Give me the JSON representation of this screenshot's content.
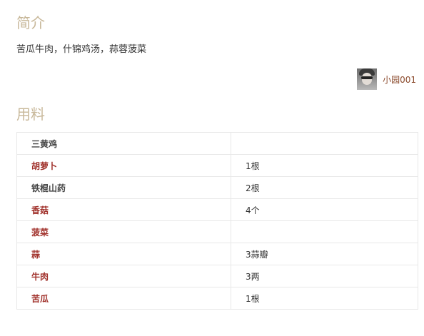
{
  "intro": {
    "title": "简介",
    "text": "苦瓜牛肉，什锦鸡汤，蒜蓉菠菜"
  },
  "author": {
    "name": "小园001"
  },
  "ingredients": {
    "title": "用料",
    "rows": [
      {
        "name": "三黄鸡",
        "amount": "",
        "linked": false
      },
      {
        "name": "胡萝卜",
        "amount": "1根",
        "linked": true
      },
      {
        "name": "铁棍山药",
        "amount": "2根",
        "linked": false
      },
      {
        "name": "香菇",
        "amount": "4个",
        "linked": true
      },
      {
        "name": "菠菜",
        "amount": "",
        "linked": true
      },
      {
        "name": "蒜",
        "amount": "3蒜瓣",
        "linked": true
      },
      {
        "name": "牛肉",
        "amount": "3两",
        "linked": true
      },
      {
        "name": "苦瓜",
        "amount": "1根",
        "linked": true
      }
    ]
  },
  "colors": {
    "section_title": "#c8b89a",
    "link_ingredient": "#a0302a",
    "author_link": "#8b4a2c"
  }
}
